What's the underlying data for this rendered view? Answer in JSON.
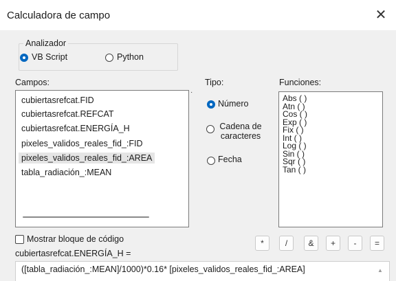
{
  "window": {
    "title": "Calculadora de campo"
  },
  "analyzer": {
    "label": "Analizador",
    "options": [
      {
        "label": "VB Script",
        "selected": true
      },
      {
        "label": "Python",
        "selected": false
      }
    ]
  },
  "fields": {
    "label": "Campos:",
    "items": [
      "cubiertasrefcat.FID",
      "cubiertasrefcat.REFCAT",
      "cubiertasrefcat.ENERGÍA_H",
      "pixeles_validos_reales_fid_:FID",
      "pixeles_validos_reales_fid_:AREA",
      "tabla_radiación_:MEAN"
    ],
    "selected_index": 4
  },
  "type": {
    "label": "Tipo:",
    "options": [
      {
        "label": "Número",
        "selected": true
      },
      {
        "label": "Cadena de caracteres",
        "selected": false
      },
      {
        "label": "Fecha",
        "selected": false
      }
    ]
  },
  "functions": {
    "label": "Funciones:",
    "items": [
      "Abs ( )",
      "Atn ( )",
      "Cos ( )",
      "Exp ( )",
      "Fix ( )",
      "Int ( )",
      "Log ( )",
      "Sin ( )",
      "Sqr ( )",
      "Tan ( )"
    ]
  },
  "codeblock": {
    "label": "Mostrar bloque de código",
    "checked": false
  },
  "operators": [
    "*",
    "/",
    "&",
    "+",
    "-",
    "="
  ],
  "expression": {
    "label": "cubiertasrefcat.ENERGÍA_H =",
    "value": "([tabla_radiación_:MEAN]/1000)*0.16* [pixeles_validos_reales_fid_:AREA]"
  },
  "colors": {
    "accent": "#0067c0",
    "dialog_bg": "#f0f0f0",
    "selection": "#e5e5e5"
  }
}
